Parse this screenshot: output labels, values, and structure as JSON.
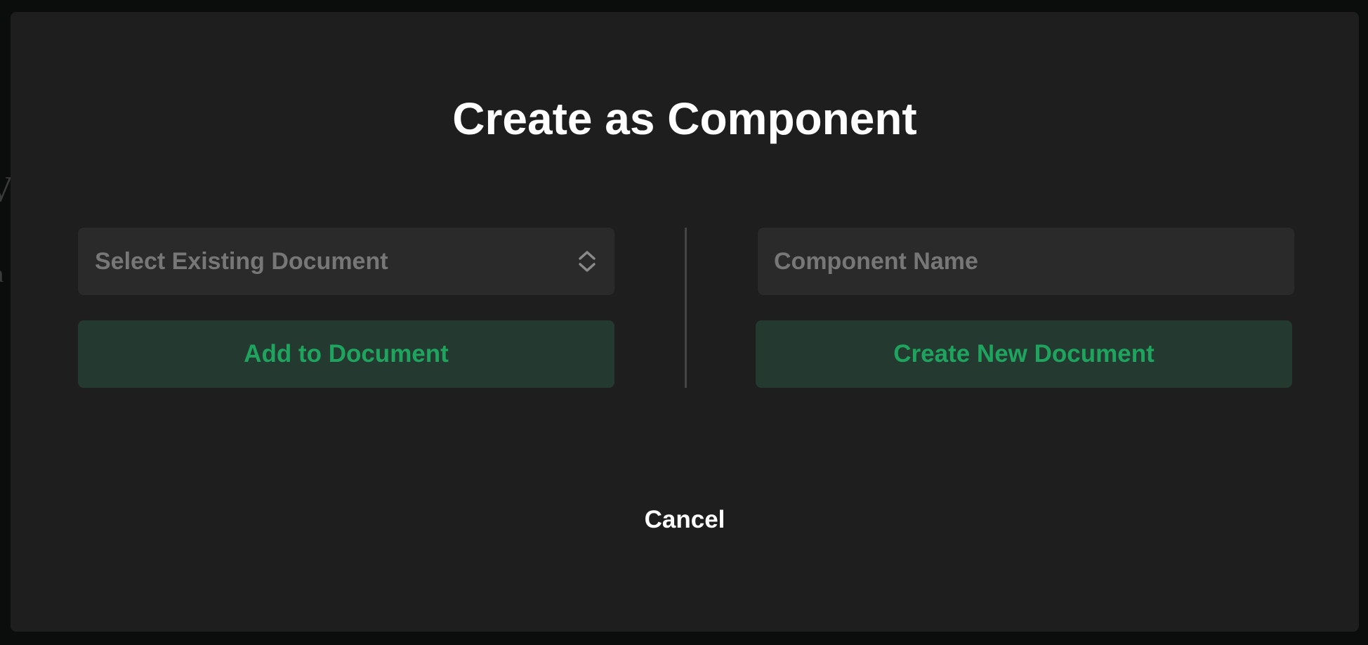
{
  "dialog": {
    "title": "Create as Component",
    "select_document": {
      "placeholder": "Select Existing Document",
      "icon": "chevron-up-down-icon"
    },
    "component_name": {
      "placeholder": "Component Name",
      "value": ""
    },
    "add_button_label": "Add to Document",
    "create_button_label": "Create New Document",
    "cancel_label": "Cancel"
  },
  "colors": {
    "modal_bg": "#1e1e1e",
    "field_bg": "#2a2a2a",
    "button_bg": "#243a30",
    "accent_green": "#1fa45f",
    "placeholder_text": "#777777"
  }
}
